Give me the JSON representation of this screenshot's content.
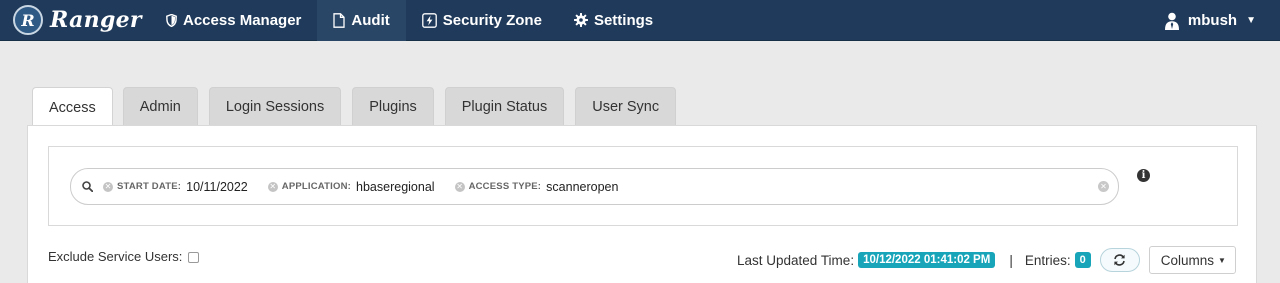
{
  "app": {
    "brand_letter": "R",
    "brand_name": "Ranger"
  },
  "nav": {
    "items": [
      {
        "label": "Access Manager",
        "icon": "shield-icon",
        "active": false
      },
      {
        "label": "Audit",
        "icon": "file-icon",
        "active": true
      },
      {
        "label": "Security Zone",
        "icon": "bolt-icon",
        "active": false
      },
      {
        "label": "Settings",
        "icon": "gear-icon",
        "active": false
      }
    ],
    "user": "mbush"
  },
  "tabs": [
    "Access",
    "Admin",
    "Login Sessions",
    "Plugins",
    "Plugin Status",
    "User Sync"
  ],
  "search": {
    "facets": [
      {
        "key": "START DATE:",
        "value": "10/11/2022"
      },
      {
        "key": "APPLICATION:",
        "value": "hbaseregional"
      },
      {
        "key": "ACCESS TYPE:",
        "value": "scanneropen"
      }
    ]
  },
  "filters": {
    "exclude_service_users_label": "Exclude Service Users:",
    "exclude_service_users_checked": false
  },
  "status": {
    "last_updated_label": "Last Updated Time:",
    "last_updated_value": "10/12/2022 01:41:02 PM",
    "separator": "|",
    "entries_label": "Entries:",
    "entries_count": "0",
    "columns_label": "Columns"
  },
  "colors": {
    "navbar": "#1f3a5a",
    "badge": "#19a5b9"
  }
}
